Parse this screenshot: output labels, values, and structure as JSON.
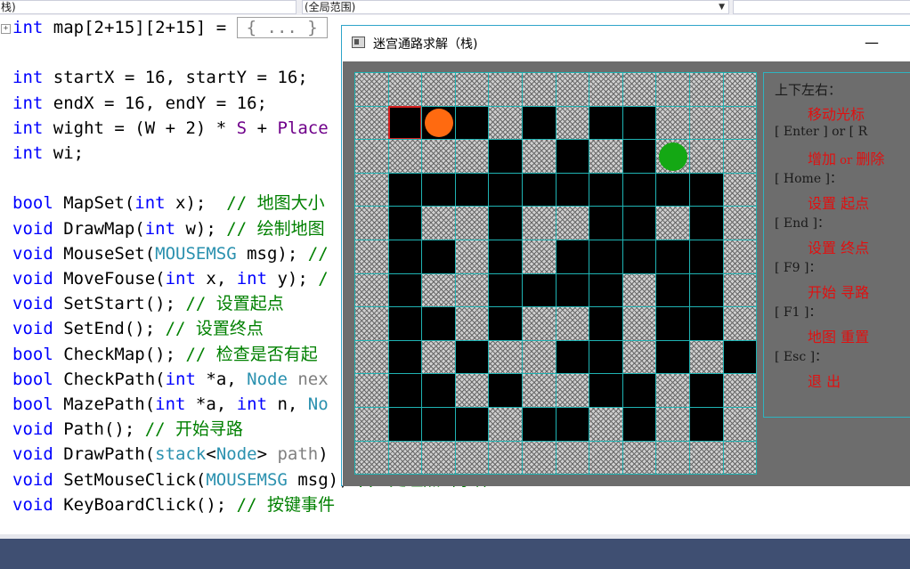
{
  "topbar": {
    "scope_left": "栈)",
    "scope_right": "(全局范围)"
  },
  "editor": {
    "collapsed_text": "{ ... }",
    "lines": [
      [
        {
          "t": "int",
          "c": "kw"
        },
        {
          "t": " map[2+15][2+15] = ",
          "c": ""
        },
        {
          "t": "{ ... }",
          "c": "box"
        }
      ],
      [],
      [
        {
          "t": "int",
          "c": "kw"
        },
        {
          "t": " startX = 16, startY = 16;",
          "c": ""
        }
      ],
      [
        {
          "t": "int",
          "c": "kw"
        },
        {
          "t": " endX = 16, endY = 16;",
          "c": ""
        }
      ],
      [
        {
          "t": "int",
          "c": "kw"
        },
        {
          "t": " wight = (W + 2) * ",
          "c": ""
        },
        {
          "t": "S",
          "c": "mc"
        },
        {
          "t": " + ",
          "c": ""
        },
        {
          "t": "Place",
          "c": "mc"
        }
      ],
      [
        {
          "t": "int",
          "c": "kw"
        },
        {
          "t": " wi;",
          "c": ""
        }
      ],
      [],
      [
        {
          "t": "bool",
          "c": "kw"
        },
        {
          "t": " MapSet(",
          "c": ""
        },
        {
          "t": "int",
          "c": "kw"
        },
        {
          "t": " x);  ",
          "c": ""
        },
        {
          "t": "// 地图大小",
          "c": "cm"
        }
      ],
      [
        {
          "t": "void",
          "c": "kw"
        },
        {
          "t": " DrawMap(",
          "c": ""
        },
        {
          "t": "int",
          "c": "kw"
        },
        {
          "t": " w); ",
          "c": ""
        },
        {
          "t": "// 绘制地图",
          "c": "cm"
        }
      ],
      [
        {
          "t": "void",
          "c": "kw"
        },
        {
          "t": " MouseSet(",
          "c": ""
        },
        {
          "t": "MOUSEMSG",
          "c": "ty"
        },
        {
          "t": " msg); ",
          "c": ""
        },
        {
          "t": "//",
          "c": "cm"
        }
      ],
      [
        {
          "t": "void",
          "c": "kw"
        },
        {
          "t": " MoveFouse(",
          "c": ""
        },
        {
          "t": "int",
          "c": "kw"
        },
        {
          "t": " x, ",
          "c": ""
        },
        {
          "t": "int",
          "c": "kw"
        },
        {
          "t": " y); ",
          "c": ""
        },
        {
          "t": "/",
          "c": "cm"
        }
      ],
      [
        {
          "t": "void",
          "c": "kw"
        },
        {
          "t": " SetStart(); ",
          "c": ""
        },
        {
          "t": "// 设置起点",
          "c": "cm"
        }
      ],
      [
        {
          "t": "void",
          "c": "kw"
        },
        {
          "t": " SetEnd(); ",
          "c": ""
        },
        {
          "t": "// 设置终点",
          "c": "cm"
        }
      ],
      [
        {
          "t": "bool",
          "c": "kw"
        },
        {
          "t": " CheckMap(); ",
          "c": ""
        },
        {
          "t": "// 检查是否有起",
          "c": "cm"
        }
      ],
      [
        {
          "t": "bool",
          "c": "kw"
        },
        {
          "t": " CheckPath(",
          "c": ""
        },
        {
          "t": "int",
          "c": "kw"
        },
        {
          "t": " *a, ",
          "c": ""
        },
        {
          "t": "Node",
          "c": "ty"
        },
        {
          "t": " nex",
          "c": "pa"
        }
      ],
      [
        {
          "t": "bool",
          "c": "kw"
        },
        {
          "t": " MazePath(",
          "c": ""
        },
        {
          "t": "int",
          "c": "kw"
        },
        {
          "t": " *a, ",
          "c": ""
        },
        {
          "t": "int",
          "c": "kw"
        },
        {
          "t": " n, ",
          "c": ""
        },
        {
          "t": "No",
          "c": "ty"
        }
      ],
      [
        {
          "t": "void",
          "c": "kw"
        },
        {
          "t": " Path(); ",
          "c": ""
        },
        {
          "t": "// 开始寻路",
          "c": "cm"
        }
      ],
      [
        {
          "t": "void",
          "c": "kw"
        },
        {
          "t": " DrawPath(",
          "c": ""
        },
        {
          "t": "stack",
          "c": "ty"
        },
        {
          "t": "<",
          "c": ""
        },
        {
          "t": "Node",
          "c": "ty"
        },
        {
          "t": "> ",
          "c": ""
        },
        {
          "t": "path",
          "c": "pa"
        },
        {
          "t": ")",
          "c": ""
        }
      ],
      [
        {
          "t": "void",
          "c": "kw"
        },
        {
          "t": " SetMouseClick(",
          "c": ""
        },
        {
          "t": "MOUSEMSG",
          "c": "ty"
        },
        {
          "t": " msg); ",
          "c": ""
        },
        {
          "t": "// 处理点击事件",
          "c": "cm"
        }
      ],
      [
        {
          "t": "void",
          "c": "kw"
        },
        {
          "t": " KeyBoardClick(); ",
          "c": ""
        },
        {
          "t": "// 按键事件",
          "c": "cm"
        }
      ]
    ]
  },
  "window": {
    "title": "迷宫通路求解（栈)",
    "minimize_symbol": "—"
  },
  "maze": {
    "rows": 12,
    "cols": 12,
    "wall_color": "#cfcfcf",
    "path_color": "#000000",
    "grid_line_color": "#1fb3b3",
    "grid": [
      "############",
      "#...#.#..###",
      "####.#.#.###",
      "#..........#",
      "#.##.##..#.#",
      "#..#.#.....#",
      "#.##....#..#",
      "#..#.##.#..#",
      "#.#.##..#.#.",
      "#..#.##..#.#",
      "#...#..#.#.#",
      "############"
    ],
    "cursor": {
      "row": 1,
      "col": 1,
      "color": "#d61f1f"
    },
    "start": {
      "row": 1,
      "col": 2,
      "color": "#ff6a10"
    },
    "end": {
      "row": 2,
      "col": 9,
      "color": "#14a814"
    }
  },
  "panel": {
    "items": [
      {
        "key": "上下左右：",
        "action": "移动光标"
      },
      {
        "key": "[ Enter ]  or  [ R",
        "action_a": "增加",
        "or": "or",
        "action_b": "删除"
      },
      {
        "key": "[ Home ]：",
        "action": "设置 起点"
      },
      {
        "key": "[ End ]：",
        "action": "设置 终点"
      },
      {
        "key": "[ F9 ]：",
        "action": "开始 寻路"
      },
      {
        "key": "[ F1 ]：",
        "action": "地图 重置"
      },
      {
        "key": "[ Esc ]：",
        "action": "退 出"
      }
    ]
  }
}
